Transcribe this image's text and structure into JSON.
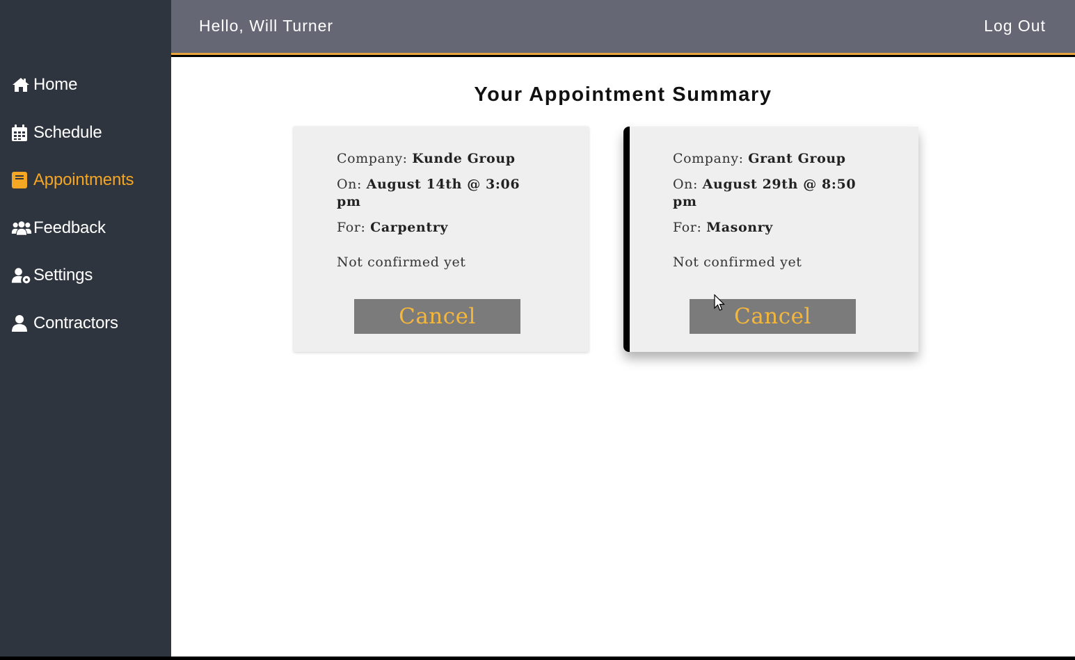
{
  "header": {
    "greeting": "Hello, Will Turner",
    "logout_label": "Log Out"
  },
  "sidebar": {
    "items": [
      {
        "label": "Home",
        "icon": "home-icon"
      },
      {
        "label": "Schedule",
        "icon": "calendar-icon"
      },
      {
        "label": "Appointments",
        "icon": "book-icon",
        "active": true
      },
      {
        "label": "Feedback",
        "icon": "users-icon"
      },
      {
        "label": "Settings",
        "icon": "user-cog-icon"
      },
      {
        "label": "Contractors",
        "icon": "user-icon"
      }
    ]
  },
  "main": {
    "title": "Your Appointment Summary",
    "appointments": [
      {
        "company_label": "Company:",
        "company": "Kunde Group",
        "on_label": "On:",
        "datetime": "August 14th @ 3:06 pm",
        "for_label": "For:",
        "service": "Carpentry",
        "status": "Not confirmed yet",
        "cancel_label": "Cancel"
      },
      {
        "company_label": "Company:",
        "company": "Grant Group",
        "on_label": "On:",
        "datetime": "August 29th @ 8:50 pm",
        "for_label": "For:",
        "service": "Masonry",
        "status": "Not confirmed yet",
        "cancel_label": "Cancel"
      }
    ]
  },
  "colors": {
    "accent": "#f5a623",
    "sidebar_bg": "#2f353e",
    "topbar_bg": "#656775",
    "button_bg": "#7b7b7b"
  }
}
